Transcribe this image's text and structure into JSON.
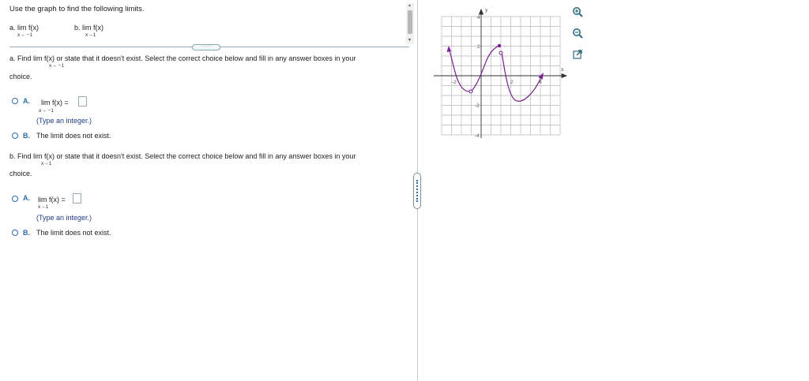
{
  "question": {
    "prompt": "Use the graph to find the following limits.",
    "part_a_label": "a.",
    "part_a_expr": "lim  f(x)",
    "part_a_sub": "x→ −1",
    "part_b_label": "b.",
    "part_b_expr": "lim f(x)",
    "part_b_sub": "x→1"
  },
  "expander": "······",
  "section_a": {
    "text_start": "a. Find  lim  f(x) or state that it doesn't exist. Select the correct choice below and fill in any answer boxes in your",
    "sub": "x→ −1",
    "text_end": "choice.",
    "option_a_letter": "A.",
    "option_a_expr": "lim  f(x) =",
    "option_a_sub": "x→ −1",
    "option_a_hint": "(Type an integer.)",
    "option_b_letter": "B.",
    "option_b_text": "The limit does not exist."
  },
  "section_b": {
    "text_start": "b. Find lim f(x) or state that it doesn't exist. Select the correct choice below and fill in any answer boxes in your",
    "sub": "x→1",
    "text_end": "choice.",
    "option_a_letter": "A.",
    "option_a_expr": "lim f(x) =",
    "option_a_sub": "x→1",
    "option_a_hint": "(Type an integer.)",
    "option_b_letter": "B.",
    "option_b_text": "The limit does not exist."
  },
  "graph": {
    "y_axis_label": "y",
    "x_axis_label": "x",
    "tick_labels": {
      "y_top": "4",
      "y_2": "2",
      "y_neg2": "-2",
      "y_neg4": "-4",
      "x_neg2": "-2",
      "x_2": "2",
      "x_4": "4"
    },
    "curve_color": "#7a1f8f"
  },
  "tools": {
    "zoom_in": "zoom-in-icon",
    "zoom_out": "zoom-out-icon",
    "popout": "external-link-icon"
  },
  "colors": {
    "accent": "#2b6cb0",
    "curve": "#7a1f8f"
  }
}
